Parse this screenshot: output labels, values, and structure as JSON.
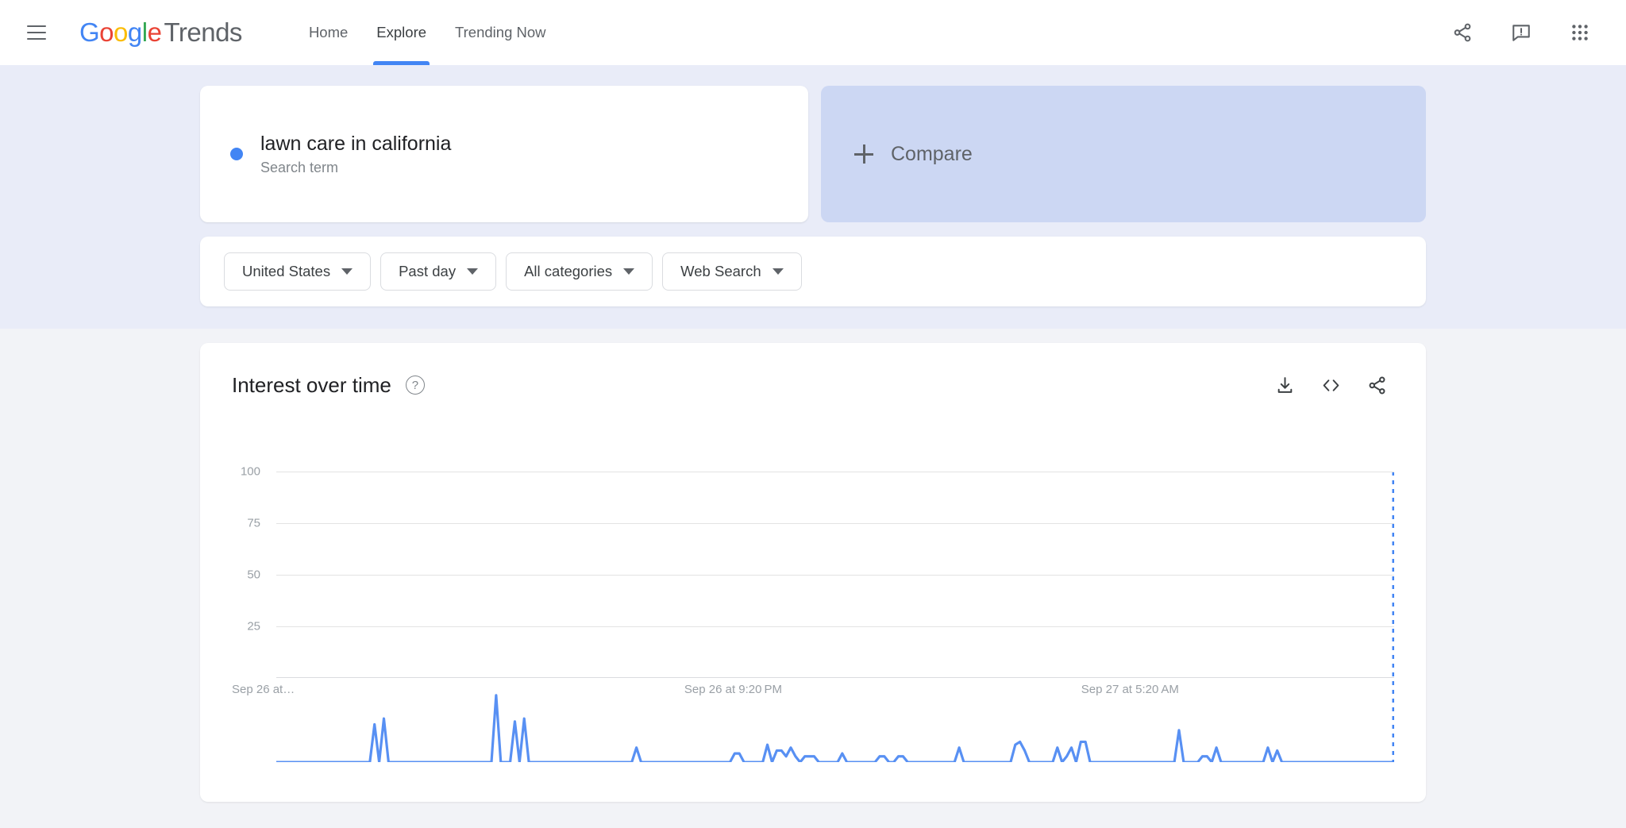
{
  "header": {
    "menu_icon": "hamburger-menu-icon",
    "logo": {
      "google": "Google",
      "product": "Trends"
    },
    "nav": [
      {
        "label": "Home",
        "active": false
      },
      {
        "label": "Explore",
        "active": true
      },
      {
        "label": "Trending Now",
        "active": false
      }
    ],
    "actions": [
      {
        "name": "share-icon",
        "label": "Share"
      },
      {
        "name": "feedback-icon",
        "label": "Send feedback"
      },
      {
        "name": "google-apps-icon",
        "label": "Google apps"
      }
    ]
  },
  "query": {
    "term": "lawn care in california",
    "type": "Search term",
    "dot_color": "#4285F4",
    "compare_label": "Compare",
    "compare_plus_icon": "plus-icon"
  },
  "filters": [
    {
      "name": "location-filter",
      "value": "United States"
    },
    {
      "name": "time-range-filter",
      "value": "Past day"
    },
    {
      "name": "category-filter",
      "value": "All categories"
    },
    {
      "name": "search-type-filter",
      "value": "Web Search"
    }
  ],
  "chart_panel": {
    "title": "Interest over time",
    "help_icon": "help-question-icon",
    "actions": [
      {
        "name": "download-icon",
        "label": "Download CSV"
      },
      {
        "name": "embed-code-icon",
        "label": "Embed"
      },
      {
        "name": "share-icon",
        "label": "Share"
      }
    ]
  },
  "chart_data": {
    "type": "line",
    "title": "Interest over time",
    "xlabel": "",
    "ylabel": "",
    "ylim": [
      0,
      100
    ],
    "yticks": [
      100,
      75,
      50,
      25
    ],
    "grid": true,
    "legend": "hidden",
    "line_color": "#5890F3",
    "x_tick_labels": [
      {
        "label": "Sep 26 at…",
        "position_pct": 0
      },
      {
        "label": "Sep 26 at 9:20 PM",
        "position_pct": 36.5
      },
      {
        "label": "Sep 27 at 5:20 AM",
        "position_pct": 72.0
      }
    ],
    "partial_data_marker": {
      "style": "dotted-vertical-line",
      "position_pct": 100,
      "color": "#4285F4"
    },
    "series": [
      {
        "name": "lawn care in california",
        "color": "#5890F3",
        "values": [
          0,
          0,
          0,
          0,
          0,
          0,
          0,
          0,
          0,
          0,
          0,
          0,
          0,
          0,
          0,
          0,
          0,
          0,
          0,
          0,
          0,
          13,
          0,
          15,
          0,
          0,
          0,
          0,
          0,
          0,
          0,
          0,
          0,
          0,
          0,
          0,
          0,
          0,
          0,
          0,
          0,
          0,
          0,
          0,
          0,
          0,
          0,
          23,
          0,
          0,
          0,
          14,
          0,
          15,
          0,
          0,
          0,
          0,
          0,
          0,
          0,
          0,
          0,
          0,
          0,
          0,
          0,
          0,
          0,
          0,
          0,
          0,
          0,
          0,
          0,
          0,
          0,
          5,
          0,
          0,
          0,
          0,
          0,
          0,
          0,
          0,
          0,
          0,
          0,
          0,
          0,
          0,
          0,
          0,
          0,
          0,
          0,
          0,
          3,
          3,
          0,
          0,
          0,
          0,
          0,
          6,
          0,
          4,
          4,
          2,
          5,
          2,
          0,
          2,
          2,
          2,
          0,
          0,
          0,
          0,
          0,
          3,
          0,
          0,
          0,
          0,
          0,
          0,
          0,
          2,
          2,
          0,
          0,
          2,
          2,
          0,
          0,
          0,
          0,
          0,
          0,
          0,
          0,
          0,
          0,
          0,
          5,
          0,
          0,
          0,
          0,
          0,
          0,
          0,
          0,
          0,
          0,
          0,
          6,
          7,
          4,
          0,
          0,
          0,
          0,
          0,
          0,
          5,
          0,
          2,
          5,
          0,
          7,
          7,
          0,
          0,
          0,
          0,
          0,
          0,
          0,
          0,
          0,
          0,
          0,
          0,
          0,
          0,
          0,
          0,
          0,
          0,
          0,
          11,
          0,
          0,
          0,
          0,
          2,
          2,
          0,
          5,
          0,
          0,
          0,
          0,
          0,
          0,
          0,
          0,
          0,
          0,
          5,
          0,
          4,
          0,
          0,
          0,
          0,
          0,
          0,
          0,
          0,
          0,
          0,
          0,
          0,
          0,
          0,
          0,
          0,
          0,
          0,
          0,
          0,
          0,
          0,
          0,
          0,
          0
        ]
      }
    ]
  }
}
